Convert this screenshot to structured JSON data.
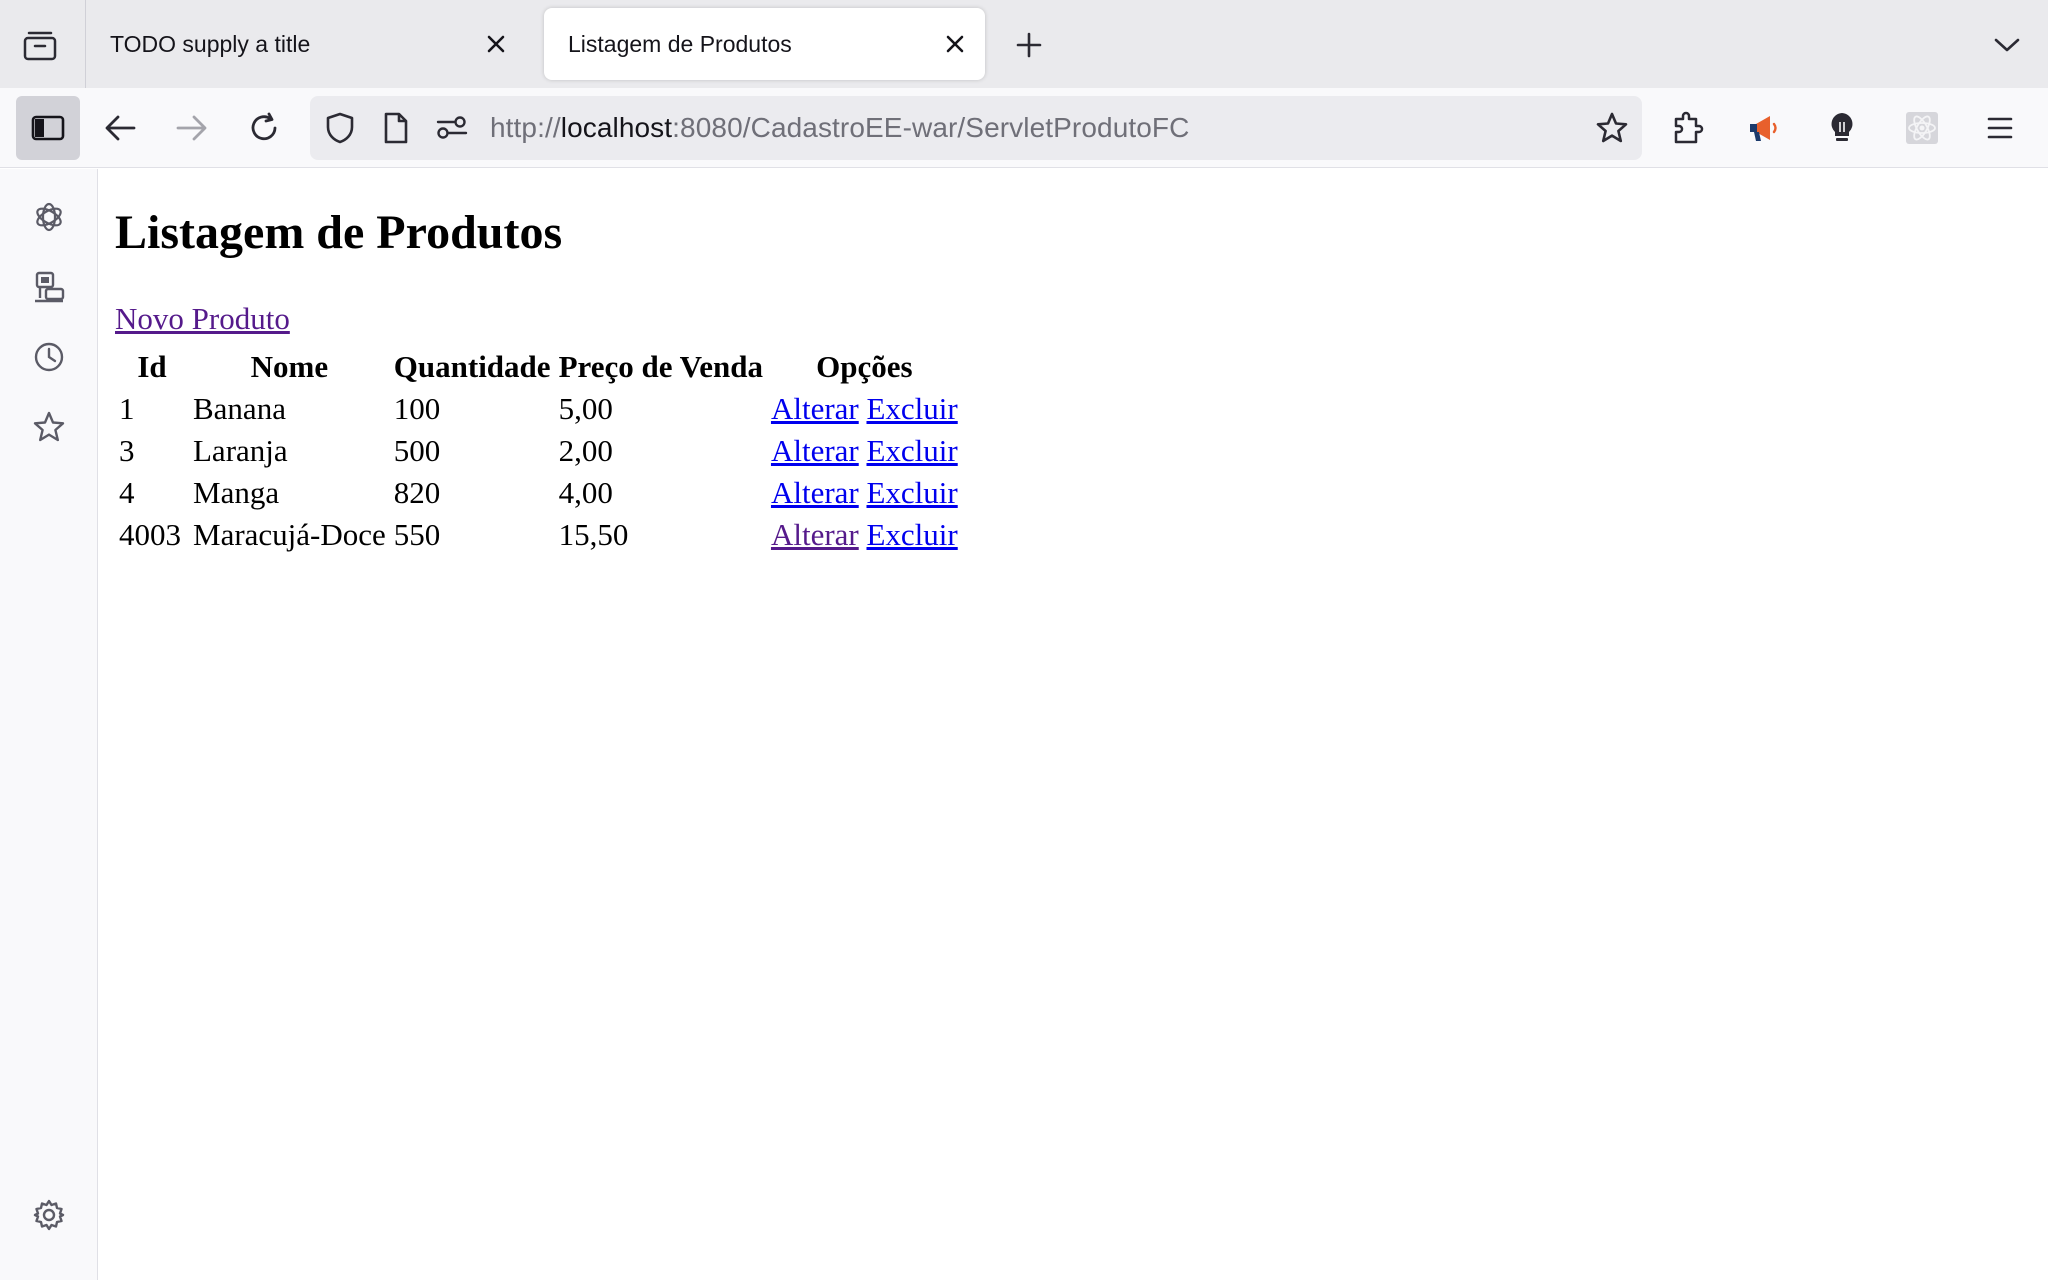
{
  "browser": {
    "tabs": [
      {
        "title": "TODO supply a title",
        "active": false
      },
      {
        "title": "Listagem de Produtos",
        "active": true
      }
    ],
    "url": {
      "scheme": "http://",
      "host": "localhost",
      "rest": ":8080/CadastroEE-war/ServletProdutoFC"
    },
    "icons": {
      "tab_list": "tab-list-icon",
      "new_tab": "plus-icon",
      "tab_overflow": "chevron-down-icon",
      "sidebar_toggle": "sidebar-icon",
      "back": "arrow-left-icon",
      "forward": "arrow-right-icon",
      "reload": "reload-icon",
      "shield": "shield-icon",
      "page": "page-icon",
      "permissions": "permissions-icon",
      "bookmark": "star-icon",
      "extensions": "puzzle-icon",
      "menu": "hamburger-icon"
    },
    "sidebar_items": [
      "chatgpt-icon",
      "synced-devices-icon",
      "history-icon",
      "bookmarks-icon",
      "settings-icon"
    ]
  },
  "page": {
    "title": "Listagem de Produtos",
    "new_link": "Novo Produto",
    "table": {
      "headers": [
        "Id",
        "Nome",
        "Quantidade",
        "Preço de Venda",
        "Opções"
      ],
      "rows": [
        {
          "id": "1",
          "nome": "Banana",
          "quantidade": "100",
          "preco": "5,00",
          "alterar": "Alterar",
          "excluir": "Excluir"
        },
        {
          "id": "3",
          "nome": "Laranja",
          "quantidade": "500",
          "preco": "2,00",
          "alterar": "Alterar",
          "excluir": "Excluir"
        },
        {
          "id": "4",
          "nome": "Manga",
          "quantidade": "820",
          "preco": "4,00",
          "alterar": "Alterar",
          "excluir": "Excluir"
        },
        {
          "id": "4003",
          "nome": "Maracujá-Doce",
          "quantidade": "550",
          "preco": "15,50",
          "alterar": "Alterar",
          "excluir": "Excluir"
        }
      ]
    }
  },
  "colors": {
    "link": "#0000ee",
    "visited_link": "#551a8b",
    "toolbar": "#f9f9fb",
    "tabstrip": "#eaeaed"
  }
}
